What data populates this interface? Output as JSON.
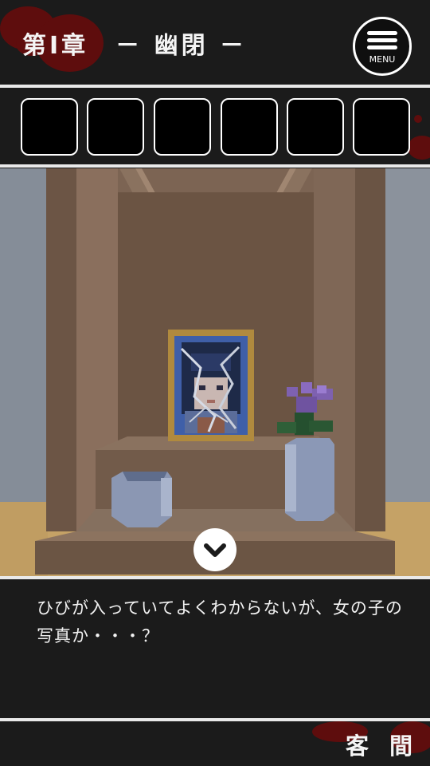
{
  "header": {
    "chapter_title": "第Ⅰ章　－ 幽閉 －",
    "menu_label": "MENU"
  },
  "inventory": {
    "slots": [
      "",
      "",
      "",
      "",
      "",
      ""
    ]
  },
  "dialog": {
    "text": "ひびが入っていてよくわからないが、女の子の写真か・・・？"
  },
  "footer": {
    "location": "客間"
  },
  "icons": {
    "menu": "hamburger-menu-icon",
    "next": "chevron-down-icon"
  },
  "colors": {
    "background": "#1b1b1b",
    "divider": "#e9e9e9",
    "blood": "#5e0d0d",
    "altar_wood": "#6f5848",
    "frame_gold": "#b08a3e",
    "flower_purple": "#7e61b0"
  }
}
